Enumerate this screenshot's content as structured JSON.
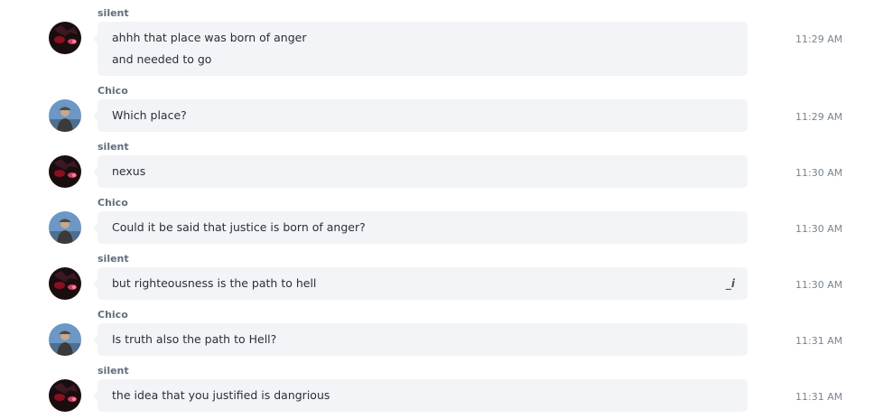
{
  "messages": [
    {
      "author": "silent",
      "lines": [
        "ahhh that place was born of anger",
        "and needed to go"
      ],
      "time": "11:29 AM",
      "avatar": "silent-avatar"
    },
    {
      "author": "Chico",
      "lines": [
        "Which place?"
      ],
      "time": "11:29 AM",
      "avatar": "chico-avatar"
    },
    {
      "author": "silent",
      "lines": [
        "nexus"
      ],
      "time": "11:30 AM",
      "avatar": "silent-avatar"
    },
    {
      "author": "Chico",
      "lines": [
        "Could it be said that justice is born of anger?"
      ],
      "time": "11:30 AM",
      "avatar": "chico-avatar"
    },
    {
      "author": "silent",
      "lines": [
        "but righteousness is the path to hell"
      ],
      "time": "11:30 AM",
      "avatar": "silent-avatar",
      "edit_icon": "_i"
    },
    {
      "author": "Chico",
      "lines": [
        "Is truth also the path to Hell?"
      ],
      "time": "11:31 AM",
      "avatar": "chico-avatar"
    },
    {
      "author": "silent",
      "lines": [
        "the idea that you justified is dangrious"
      ],
      "time": "11:31 AM",
      "avatar": "silent-avatar"
    }
  ],
  "colors": {
    "bubble": "#f2f4f7",
    "author": "#626d7a",
    "text": "#2a2f36",
    "time": "#7a8591"
  }
}
